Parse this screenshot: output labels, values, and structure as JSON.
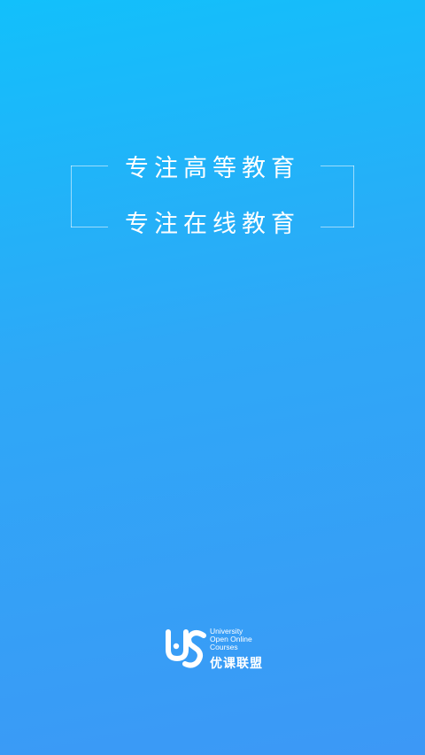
{
  "slogan": {
    "line1": "专注高等教育",
    "line2": "专注在线教育"
  },
  "brand": {
    "english_lines": [
      "University",
      "Open Online",
      "Courses"
    ],
    "chinese_name": "优课联盟",
    "logo_icon": "uooc-logo-icon"
  },
  "colors": {
    "background_top": "#12c0fb",
    "background_bottom": "#3c98f6",
    "text": "#ffffff"
  }
}
